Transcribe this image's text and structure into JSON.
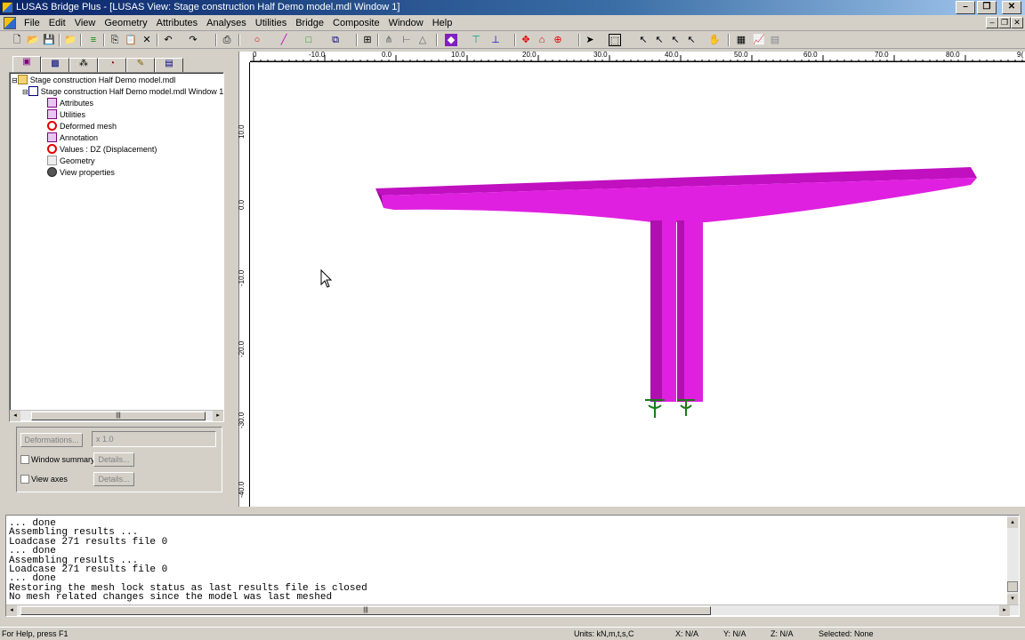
{
  "window": {
    "title": "LUSAS Bridge Plus - [LUSAS View: Stage construction Half Demo model.mdl Window 1]",
    "minimize": "–",
    "restore": "❐",
    "close": "✕"
  },
  "menu": {
    "items": [
      "File",
      "Edit",
      "View",
      "Geometry",
      "Attributes",
      "Analyses",
      "Utilities",
      "Bridge",
      "Composite",
      "Window",
      "Help"
    ]
  },
  "toolbar": {
    "icons": [
      "new-icon",
      "open-icon",
      "save-icon",
      "open-folder-icon",
      "layers-icon",
      "copy-icon",
      "paste-icon",
      "delete-icon",
      "undo-icon",
      "redo-icon",
      "print-icon",
      "point-icon",
      "line-icon",
      "surface-icon",
      "volume-icon",
      "mesh-icon",
      "support-icon",
      "load-icon",
      "result-icon",
      "deform-icon",
      "move-icon",
      "home-icon",
      "rotate-icon",
      "select-icon",
      "select-box-icon",
      "pick-icon",
      "chart-icon",
      "table-icon"
    ]
  },
  "tree": {
    "tabs": [
      "layers-tab-icon",
      "groups-tab-icon",
      "attributes-tab-icon",
      "loadcases-tab-icon",
      "analyses-tab-icon",
      "report-tab-icon"
    ],
    "root": "Stage construction Half Demo model.mdl",
    "window": "Stage construction Half Demo model.mdl Window 1",
    "items": [
      {
        "label": "Attributes",
        "icon": "layer-icon"
      },
      {
        "label": "Utilities",
        "icon": "layer-icon"
      },
      {
        "label": "Deformed mesh",
        "icon": "disabled-icon"
      },
      {
        "label": "Annotation",
        "icon": "layer-icon"
      },
      {
        "label": "Values : DZ (Displacement)",
        "icon": "disabled-icon"
      },
      {
        "label": "Geometry",
        "icon": "geometry-icon"
      },
      {
        "label": "View properties",
        "icon": "gears-icon"
      }
    ]
  },
  "props": {
    "deformations_button": "Deformations...",
    "scale_value": "x 1.0",
    "window_summary_label": "Window summary",
    "view_axes_label": "View axes",
    "details_button": "Details..."
  },
  "ruler": {
    "h_labels": [
      "0",
      "-10.0",
      "0.0",
      "10.0",
      "20.0",
      "30.0",
      "40.0",
      "50.0",
      "60.0",
      "70.0",
      "80.0",
      "9("
    ],
    "v_labels": [
      "10.0",
      "0.0",
      "-10.0",
      "-20.0",
      "-30.0",
      "-40.0"
    ]
  },
  "model": {
    "color": "#e010e0",
    "dark_color": "#a000a0",
    "support_color": "#1a7a1a"
  },
  "console": {
    "lines": [
      "... done",
      "Assembling results ...",
      "Loadcase 271 results file 0",
      "... done",
      "Assembling results ...",
      "Loadcase 271 results file 0",
      "... done",
      "Restoring the mesh lock status as last results file is closed",
      "No mesh related changes since the model was last meshed"
    ]
  },
  "status": {
    "help": "For Help, press F1",
    "units": "Units: kN,m,t,s,C",
    "x": "X: N/A",
    "y": "Y: N/A",
    "z": "Z: N/A",
    "selected": "Selected: None"
  }
}
